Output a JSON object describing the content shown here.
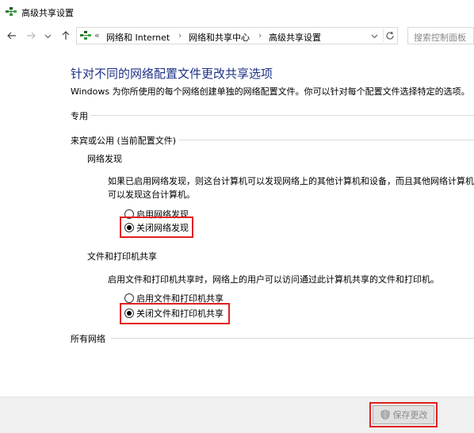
{
  "window": {
    "title": "高级共享设置"
  },
  "address_bar": {
    "prefix": "«",
    "crumbs": [
      "网络和 Internet",
      "网络和共享中心",
      "高级共享设置"
    ],
    "separator": "›",
    "search_placeholder": "搜索控制面板"
  },
  "main": {
    "heading": "针对不同的网络配置文件更改共享选项",
    "description": "Windows 为你所使用的每个网络创建单独的网络配置文件。你可以针对每个配置文件选择特定的选项。",
    "sections": {
      "private": "专用",
      "guest_public": "来宾或公用 (当前配置文件)",
      "all_networks": "所有网络"
    },
    "network_discovery": {
      "title": "网络发现",
      "description_line1": "如果已启用网络发现，则这台计算机可以发现网络上的其他计算机和设备，而且其他网络计算机",
      "description_line2": "可以发现这台计算机。",
      "option_on": "启用网络发现",
      "option_off": "关闭网络发现",
      "selected": "off"
    },
    "file_printer_sharing": {
      "title": "文件和打印机共享",
      "description": "启用文件和打印机共享时，网络上的用户可以访问通过此计算机共享的文件和打印机。",
      "option_on": "启用文件和打印机共享",
      "option_off": "关闭文件和打印机共享",
      "selected": "off"
    }
  },
  "footer": {
    "save_label": "保存更改"
  },
  "colors": {
    "heading": "#1e3287",
    "highlight_box": "#e02020",
    "footer_bg": "#f0f0f0"
  }
}
